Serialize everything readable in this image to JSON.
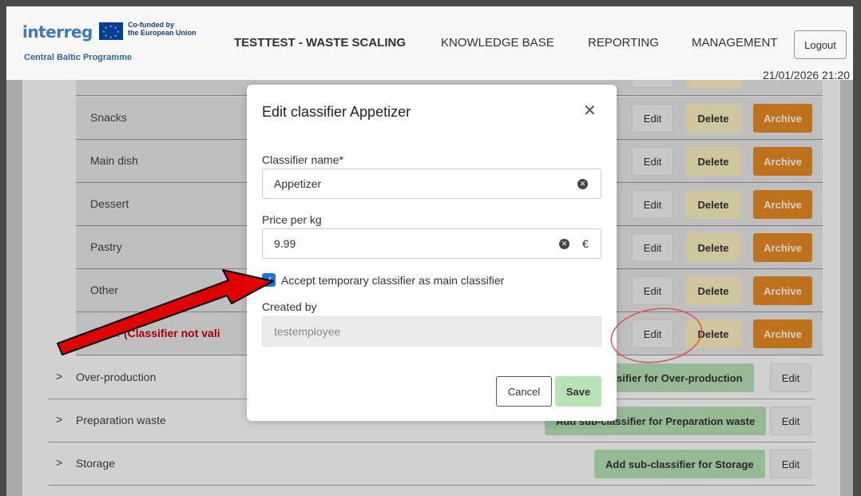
{
  "header": {
    "logo": "interreg",
    "eu_line1": "Co-funded by",
    "eu_line2": "the European Union",
    "programme": "Central Baltic Programme",
    "nav": [
      "TESTTEST - WASTE SCALING",
      "KNOWLEDGE BASE",
      "REPORTING",
      "MANAGEMENT"
    ],
    "logout_label": "Logout",
    "datetime": "21/01/2026 21:20"
  },
  "subclassifiers": [
    {
      "label": "Snacks"
    },
    {
      "label": "Main dish"
    },
    {
      "label": "Dessert"
    },
    {
      "label": "Pastry"
    },
    {
      "label": "Other"
    },
    {
      "label": "...tizer",
      "invalid": "(Classifier not vali"
    }
  ],
  "row_buttons": {
    "edit": "Edit",
    "delete": "Delete",
    "archive": "Archive"
  },
  "classifiers": [
    {
      "label": "Over-production",
      "add": "...ssifier for Over-production",
      "edit": "Edit"
    },
    {
      "label": "Preparation waste",
      "add": "Add sub-classifier for Preparation waste",
      "edit": "Edit"
    },
    {
      "label": "Storage",
      "add": "Add sub-classifier for Storage",
      "edit": "Edit"
    }
  ],
  "modal": {
    "title": "Edit classifier Appetizer",
    "name_label": "Classifier name*",
    "name_value": "Appetizer",
    "price_label": "Price per kg",
    "price_value": "9.99",
    "currency": "€",
    "accept_label": "Accept temporary classifier as main classifier",
    "accept_checked": true,
    "created_label": "Created by",
    "created_value": "testemployee",
    "cancel": "Cancel",
    "save": "Save"
  },
  "colors": {
    "archive": "#e78b22",
    "delete": "#fdf2c4",
    "add": "#b8e3b6",
    "checkbox": "#1a73e8",
    "arrow": "#e00000"
  }
}
